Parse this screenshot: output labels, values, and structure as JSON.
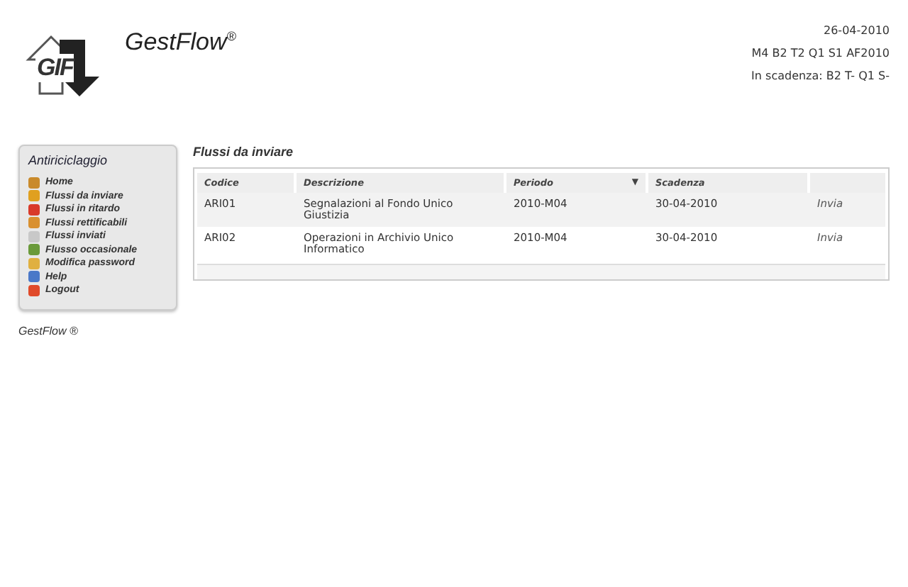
{
  "header": {
    "logo_text": "GIF",
    "app_name": "GestFlow",
    "app_mark": "®",
    "date": "26-04-2010",
    "period_code": "M4 B2 T2 Q1 S1 AF2010",
    "due": "In scadenza: B2 T- Q1 S-"
  },
  "sidebar": {
    "title": "Antiriciclaggio",
    "items": [
      {
        "label": "Home"
      },
      {
        "label": "Flussi da inviare"
      },
      {
        "label": "Flussi in ritardo"
      },
      {
        "label": "Flussi rettificabili"
      },
      {
        "label": "Flussi inviati"
      },
      {
        "label": "Flusso occasionale"
      },
      {
        "label": "Modifica password"
      },
      {
        "label": "Help"
      },
      {
        "label": "Logout"
      }
    ],
    "footer": "GestFlow ®"
  },
  "main": {
    "title": "Flussi da inviare",
    "table": {
      "columns": [
        {
          "label": "Codice"
        },
        {
          "label": "Descrizione"
        },
        {
          "label": "Periodo",
          "sort_mark": "▼"
        },
        {
          "label": "Scadenza"
        }
      ],
      "rows": [
        {
          "code": "ARI01",
          "description": "Segnalazioni al Fondo Unico Giustizia",
          "period": "2010-M04",
          "due": "30-04-2010",
          "action": "Invia"
        },
        {
          "code": "ARI02",
          "description": "Operazioni in Archivio Unico Informatico",
          "period": "2010-M04",
          "due": "30-04-2010",
          "action": "Invia"
        }
      ]
    }
  }
}
